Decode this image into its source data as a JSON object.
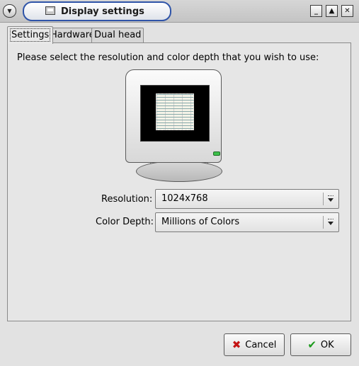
{
  "window": {
    "title": "Display settings",
    "menu_icon": "chevron-down-icon",
    "controls": {
      "minimize": "_",
      "maximize": "▲",
      "close": "✕"
    }
  },
  "tabs": [
    {
      "label": "Settings",
      "active": true
    },
    {
      "label": "Hardware",
      "active": false
    },
    {
      "label": "Dual head",
      "active": false
    }
  ],
  "settings": {
    "instruction": "Please select the resolution and color depth that you wish to use:",
    "resolution": {
      "label": "Resolution:",
      "value": "1024x768"
    },
    "color_depth": {
      "label": "Color Depth:",
      "value": "Millions of Colors"
    }
  },
  "buttons": {
    "cancel": "Cancel",
    "ok": "OK"
  },
  "colors": {
    "title_accent": "#2f54a8",
    "cancel_icon": "#c41414",
    "ok_icon": "#1c9a1c",
    "monitor_led": "#3cc04a"
  }
}
